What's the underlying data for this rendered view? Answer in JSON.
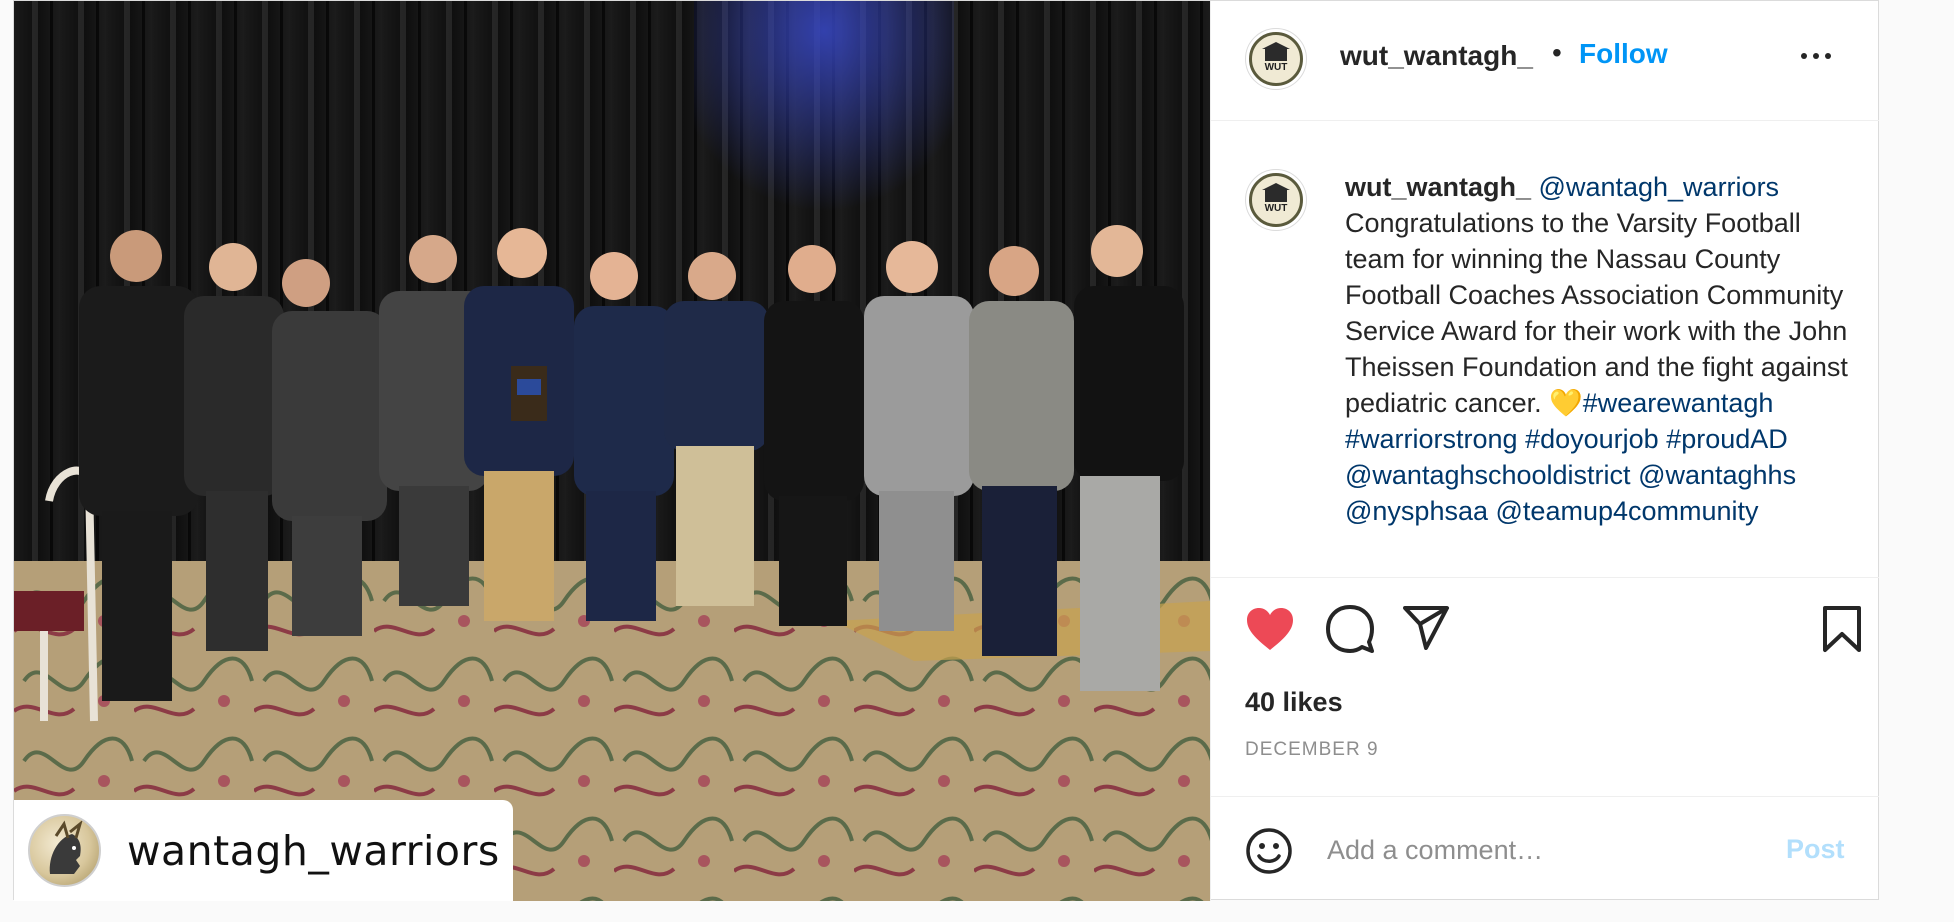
{
  "photo": {
    "tag_username": "wantagh_warriors",
    "tag_avatar_icon": "warrior-logo-icon"
  },
  "header": {
    "username": "wut_wantagh_",
    "separator": "•",
    "follow_label": "Follow",
    "more_icon": "more-options-icon",
    "avatar_text": "WUT"
  },
  "caption": {
    "username": "wut_wantagh_",
    "mention_first": "@wantagh_warriors",
    "text": "Congratulations to the Varsity Football team for winning the Nassau County Football Coaches Association Community Service Award for their work with the John Theissen Foundation and the fight against pediatric cancer.",
    "emoji": "💛",
    "tags": [
      "#wearewantagh",
      "#warriorstrong",
      "#doyourjob",
      "#proudAD",
      "@wantaghschooldistrict",
      "@wantaghhs",
      "@nysphsaa",
      "@teamup4community"
    ]
  },
  "actions": {
    "like_icon": "heart-filled-icon",
    "comment_icon": "comment-icon",
    "share_icon": "share-icon",
    "save_icon": "bookmark-icon",
    "like_color": "#ed4956"
  },
  "likes_text": "40 likes",
  "date_text": "DECEMBER 9",
  "comment": {
    "emoji_icon": "emoji-icon",
    "placeholder": "Add a comment…",
    "value": "",
    "post_label": "Post"
  },
  "colors": {
    "link_blue": "#0095f6",
    "mention_blue": "#00376b",
    "muted_gray": "#8e8e8e",
    "post_disabled": "#b2dffc"
  }
}
